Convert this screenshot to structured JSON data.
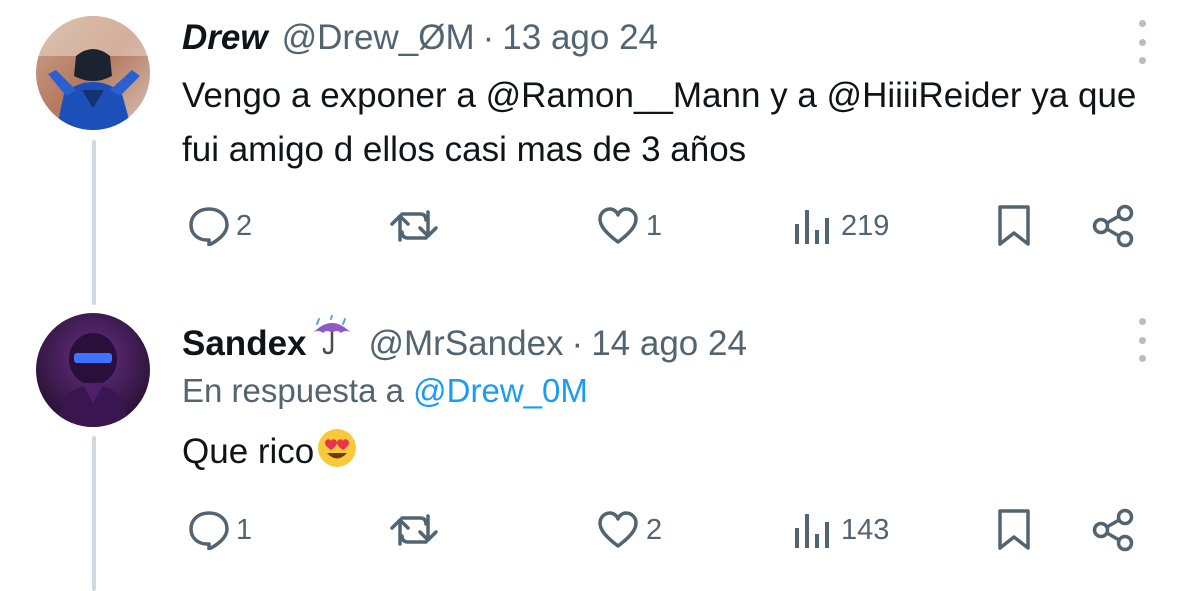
{
  "tweets": [
    {
      "avatar": "avatar-drew",
      "display_name": "Drew",
      "handle": "@Drew_ØM",
      "separator": "·",
      "date": "13 ago 24",
      "text": "Vengo a exponer a @Ramon__Mann y a @HiiiiReider ya que fui amigo d ellos casi mas de 3 años",
      "replies": "2",
      "retweets": "",
      "likes": "1",
      "views": "219"
    },
    {
      "avatar": "avatar-sandex",
      "display_name": "Sandex",
      "name_emoji": "umbrella-with-rain-icon",
      "handle": "@MrSandex",
      "separator": "·",
      "date": "14 ago 24",
      "reply_prefix": "En respuesta a",
      "reply_mention": "@Drew_0M",
      "text": "Que rico",
      "text_emoji": "heart-eyes-emoji",
      "replies": "1",
      "retweets": "",
      "likes": "2",
      "views": "143"
    }
  ],
  "colors": {
    "text_primary": "#0f1419",
    "text_secondary": "#536471",
    "mention": "#1d9bf0",
    "thread_line": "#cfd9de"
  }
}
